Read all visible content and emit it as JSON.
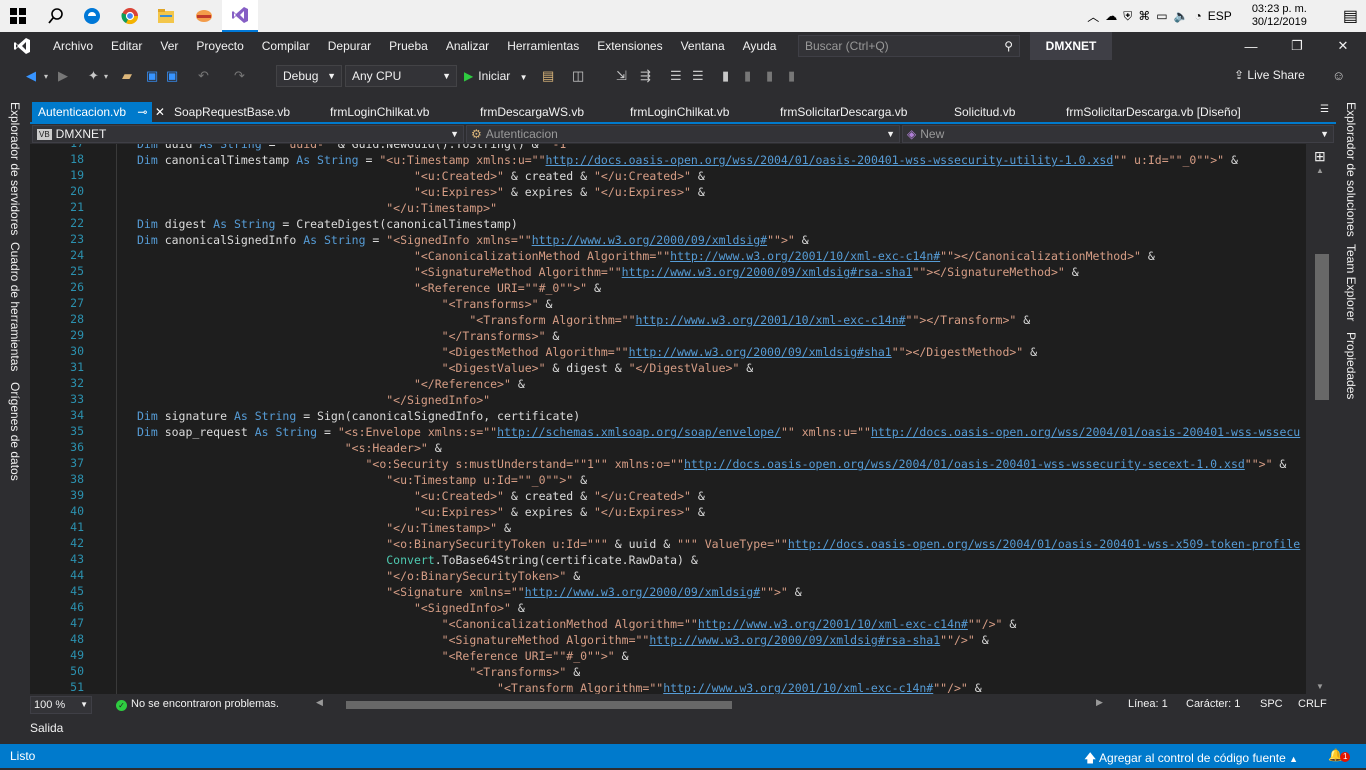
{
  "taskbar": {
    "icons": [
      "windows-start-icon",
      "search-icon",
      "edge-icon",
      "chrome-icon",
      "file-explorer-icon",
      "app-icon",
      "visual-studio-icon"
    ],
    "tray_language": "ESP",
    "clock_time": "03:23 p. m.",
    "clock_date": "30/12/2019"
  },
  "menubar": {
    "items": [
      "Archivo",
      "Editar",
      "Ver",
      "Proyecto",
      "Compilar",
      "Depurar",
      "Prueba",
      "Analizar",
      "Herramientas",
      "Extensiones",
      "Ventana",
      "Ayuda"
    ],
    "search_placeholder": "Buscar (Ctrl+Q)",
    "solution_name": "DMXNET"
  },
  "toolbar": {
    "configuration": "Debug",
    "platform": "Any CPU",
    "start_label": "Iniciar",
    "live_share_label": "Live Share"
  },
  "left_panels": [
    "Explorador de servidores",
    "Cuadro de herramientas",
    "Orígenes de datos"
  ],
  "right_panels": [
    "Explorador de soluciones",
    "Team Explorer",
    "Propiedades"
  ],
  "tabs": [
    {
      "label": "Autenticacion.vb",
      "active": true
    },
    {
      "label": "SoapRequestBase.vb"
    },
    {
      "label": "frmLoginChilkat.vb"
    },
    {
      "label": "frmDescargaWS.vb"
    },
    {
      "label": "frmLoginChilkat.vb"
    },
    {
      "label": "frmSolicitarDescarga.vb"
    },
    {
      "label": "Solicitud.vb"
    },
    {
      "label": "frmSolicitarDescarga.vb [Diseño]"
    }
  ],
  "navbar": {
    "project_badge": "VB",
    "project": "DMXNET",
    "class": "Autenticacion",
    "member": "New"
  },
  "editor": {
    "line_numbers": [
      "17",
      "18",
      "19",
      "20",
      "21",
      "22",
      "23",
      "24",
      "25",
      "26",
      "27",
      "28",
      "29",
      "30",
      "31",
      "32",
      "33",
      "34",
      "35",
      "36",
      "37",
      "38",
      "39",
      "40",
      "41",
      "42",
      "43",
      "44",
      "45",
      "46",
      "47",
      "48",
      "49",
      "50",
      "51"
    ],
    "lines": [
      [
        [
          "kw",
          "Dim "
        ],
        [
          "id",
          "uuid "
        ],
        [
          "kw",
          "As String"
        ],
        [
          "id",
          " = "
        ],
        [
          "str",
          "\"uuid-\""
        ],
        [
          "id",
          " & Guid.NewGuid().ToString() & "
        ],
        [
          "str",
          "\"-1\""
        ]
      ],
      [
        [
          "kw",
          "Dim "
        ],
        [
          "id",
          "canonicalTimestamp "
        ],
        [
          "kw",
          "As String"
        ],
        [
          "id",
          " = "
        ],
        [
          "str",
          "\"<u:Timestamp xmlns:u=\"\""
        ],
        [
          "url",
          "http://docs.oasis-open.org/wss/2004/01/oasis-200401-wss-wssecurity-utility-1.0.xsd"
        ],
        [
          "str",
          "\"\" u:Id=\"\"_0\"\">\""
        ],
        [
          "id",
          " &"
        ]
      ],
      [
        [
          "id",
          "                                        "
        ],
        [
          "str",
          "\"<u:Created>\""
        ],
        [
          "id",
          " & created & "
        ],
        [
          "str",
          "\"</u:Created>\""
        ],
        [
          "id",
          " &"
        ]
      ],
      [
        [
          "id",
          "                                        "
        ],
        [
          "str",
          "\"<u:Expires>\""
        ],
        [
          "id",
          " & expires & "
        ],
        [
          "str",
          "\"</u:Expires>\""
        ],
        [
          "id",
          " &"
        ]
      ],
      [
        [
          "id",
          "                                    "
        ],
        [
          "str",
          "\"</u:Timestamp>\""
        ]
      ],
      [
        [
          "kw",
          "Dim "
        ],
        [
          "id",
          "digest "
        ],
        [
          "kw",
          "As String"
        ],
        [
          "id",
          " = CreateDigest(canonicalTimestamp)"
        ]
      ],
      [
        [
          "kw",
          "Dim "
        ],
        [
          "id",
          "canonicalSignedInfo "
        ],
        [
          "kw",
          "As String"
        ],
        [
          "id",
          " = "
        ],
        [
          "str",
          "\"<SignedInfo xmlns=\"\""
        ],
        [
          "url",
          "http://www.w3.org/2000/09/xmldsig#"
        ],
        [
          "str",
          "\"\">\""
        ],
        [
          "id",
          " &"
        ]
      ],
      [
        [
          "id",
          "                                        "
        ],
        [
          "str",
          "\"<CanonicalizationMethod Algorithm=\"\""
        ],
        [
          "url",
          "http://www.w3.org/2001/10/xml-exc-c14n#"
        ],
        [
          "str",
          "\"\"></CanonicalizationMethod>\""
        ],
        [
          "id",
          " &"
        ]
      ],
      [
        [
          "id",
          "                                        "
        ],
        [
          "str",
          "\"<SignatureMethod Algorithm=\"\""
        ],
        [
          "url",
          "http://www.w3.org/2000/09/xmldsig#rsa-sha1"
        ],
        [
          "str",
          "\"\"></SignatureMethod>\""
        ],
        [
          "id",
          " &"
        ]
      ],
      [
        [
          "id",
          "                                        "
        ],
        [
          "str",
          "\"<Reference URI=\"\"#_0\"\">\""
        ],
        [
          "id",
          " &"
        ]
      ],
      [
        [
          "id",
          "                                            "
        ],
        [
          "str",
          "\"<Transforms>\""
        ],
        [
          "id",
          " &"
        ]
      ],
      [
        [
          "id",
          "                                                "
        ],
        [
          "str",
          "\"<Transform Algorithm=\"\""
        ],
        [
          "url",
          "http://www.w3.org/2001/10/xml-exc-c14n#"
        ],
        [
          "str",
          "\"\"></Transform>\""
        ],
        [
          "id",
          " &"
        ]
      ],
      [
        [
          "id",
          "                                            "
        ],
        [
          "str",
          "\"</Transforms>\""
        ],
        [
          "id",
          " &"
        ]
      ],
      [
        [
          "id",
          "                                            "
        ],
        [
          "str",
          "\"<DigestMethod Algorithm=\"\""
        ],
        [
          "url",
          "http://www.w3.org/2000/09/xmldsig#sha1"
        ],
        [
          "str",
          "\"\"></DigestMethod>\""
        ],
        [
          "id",
          " &"
        ]
      ],
      [
        [
          "id",
          "                                            "
        ],
        [
          "str",
          "\"<DigestValue>\""
        ],
        [
          "id",
          " & digest & "
        ],
        [
          "str",
          "\"</DigestValue>\""
        ],
        [
          "id",
          " &"
        ]
      ],
      [
        [
          "id",
          "                                        "
        ],
        [
          "str",
          "\"</Reference>\""
        ],
        [
          "id",
          " &"
        ]
      ],
      [
        [
          "id",
          "                                    "
        ],
        [
          "str",
          "\"</SignedInfo>\""
        ]
      ],
      [
        [
          "kw",
          "Dim "
        ],
        [
          "id",
          "signature "
        ],
        [
          "kw",
          "As String"
        ],
        [
          "id",
          " = Sign(canonicalSignedInfo, certificate)"
        ]
      ],
      [
        [
          "kw",
          "Dim "
        ],
        [
          "id",
          "soap_request "
        ],
        [
          "kw",
          "As String"
        ],
        [
          "id",
          " = "
        ],
        [
          "str",
          "\"<s:Envelope xmlns:s=\"\""
        ],
        [
          "url",
          "http://schemas.xmlsoap.org/soap/envelope/"
        ],
        [
          "str",
          "\"\" xmlns:u=\"\""
        ],
        [
          "url",
          "http://docs.oasis-open.org/wss/2004/01/oasis-200401-wss-wssecu"
        ]
      ],
      [
        [
          "id",
          "                              "
        ],
        [
          "str",
          "\"<s:Header>\""
        ],
        [
          "id",
          " &"
        ]
      ],
      [
        [
          "id",
          "                                 "
        ],
        [
          "str",
          "\"<o:Security s:mustUnderstand=\"\"1\"\" xmlns:o=\"\""
        ],
        [
          "url",
          "http://docs.oasis-open.org/wss/2004/01/oasis-200401-wss-wssecurity-secext-1.0.xsd"
        ],
        [
          "str",
          "\"\">\""
        ],
        [
          "id",
          " &"
        ]
      ],
      [
        [
          "id",
          "                                    "
        ],
        [
          "str",
          "\"<u:Timestamp u:Id=\"\"_0\"\">\""
        ],
        [
          "id",
          " &"
        ]
      ],
      [
        [
          "id",
          "                                        "
        ],
        [
          "str",
          "\"<u:Created>\""
        ],
        [
          "id",
          " & created & "
        ],
        [
          "str",
          "\"</u:Created>\""
        ],
        [
          "id",
          " &"
        ]
      ],
      [
        [
          "id",
          "                                        "
        ],
        [
          "str",
          "\"<u:Expires>\""
        ],
        [
          "id",
          " & expires & "
        ],
        [
          "str",
          "\"</u:Expires>\""
        ],
        [
          "id",
          " &"
        ]
      ],
      [
        [
          "id",
          "                                    "
        ],
        [
          "str",
          "\"</u:Timestamp>\""
        ],
        [
          "id",
          " &"
        ]
      ],
      [
        [
          "id",
          "                                    "
        ],
        [
          "str",
          "\"<o:BinarySecurityToken u:Id=\"\"\""
        ],
        [
          "id",
          " & uuid & "
        ],
        [
          "str",
          "\"\"\" ValueType=\"\""
        ],
        [
          "url",
          "http://docs.oasis-open.org/wss/2004/01/oasis-200401-wss-x509-token-profile"
        ]
      ],
      [
        [
          "id",
          "                                    "
        ],
        [
          "cls",
          "Convert"
        ],
        [
          "id",
          ".ToBase64String(certificate.RawData) &"
        ]
      ],
      [
        [
          "id",
          "                                    "
        ],
        [
          "str",
          "\"</o:BinarySecurityToken>\""
        ],
        [
          "id",
          " &"
        ]
      ],
      [
        [
          "id",
          "                                    "
        ],
        [
          "str",
          "\"<Signature xmlns=\"\""
        ],
        [
          "url",
          "http://www.w3.org/2000/09/xmldsig#"
        ],
        [
          "str",
          "\"\">\""
        ],
        [
          "id",
          " &"
        ]
      ],
      [
        [
          "id",
          "                                        "
        ],
        [
          "str",
          "\"<SignedInfo>\""
        ],
        [
          "id",
          " &"
        ]
      ],
      [
        [
          "id",
          "                                            "
        ],
        [
          "str",
          "\"<CanonicalizationMethod Algorithm=\"\""
        ],
        [
          "url",
          "http://www.w3.org/2001/10/xml-exc-c14n#"
        ],
        [
          "str",
          "\"\"/>\""
        ],
        [
          "id",
          " &"
        ]
      ],
      [
        [
          "id",
          "                                            "
        ],
        [
          "str",
          "\"<SignatureMethod Algorithm=\"\""
        ],
        [
          "url",
          "http://www.w3.org/2000/09/xmldsig#rsa-sha1"
        ],
        [
          "str",
          "\"\"/>\""
        ],
        [
          "id",
          " &"
        ]
      ],
      [
        [
          "id",
          "                                            "
        ],
        [
          "str",
          "\"<Reference URI=\"\"#_0\"\">\""
        ],
        [
          "id",
          " &"
        ]
      ],
      [
        [
          "id",
          "                                                "
        ],
        [
          "str",
          "\"<Transforms>\""
        ],
        [
          "id",
          " &"
        ]
      ],
      [
        [
          "id",
          "                                                    "
        ],
        [
          "str",
          "\"<Transform Algorithm=\"\""
        ],
        [
          "url",
          "http://www.w3.org/2001/10/xml-exc-c14n#"
        ],
        [
          "str",
          "\"\"/>\""
        ],
        [
          "id",
          " &"
        ]
      ]
    ]
  },
  "editor_status": {
    "zoom": "100 %",
    "problems": "No se encontraron problemas.",
    "line": "Línea: 1",
    "char": "Carácter: 1",
    "spc": "SPC",
    "crlf": "CRLF"
  },
  "output_tab": "Salida",
  "statusbar": {
    "ready": "Listo",
    "source_control": "Agregar al control de código fuente",
    "notifications": "1"
  }
}
